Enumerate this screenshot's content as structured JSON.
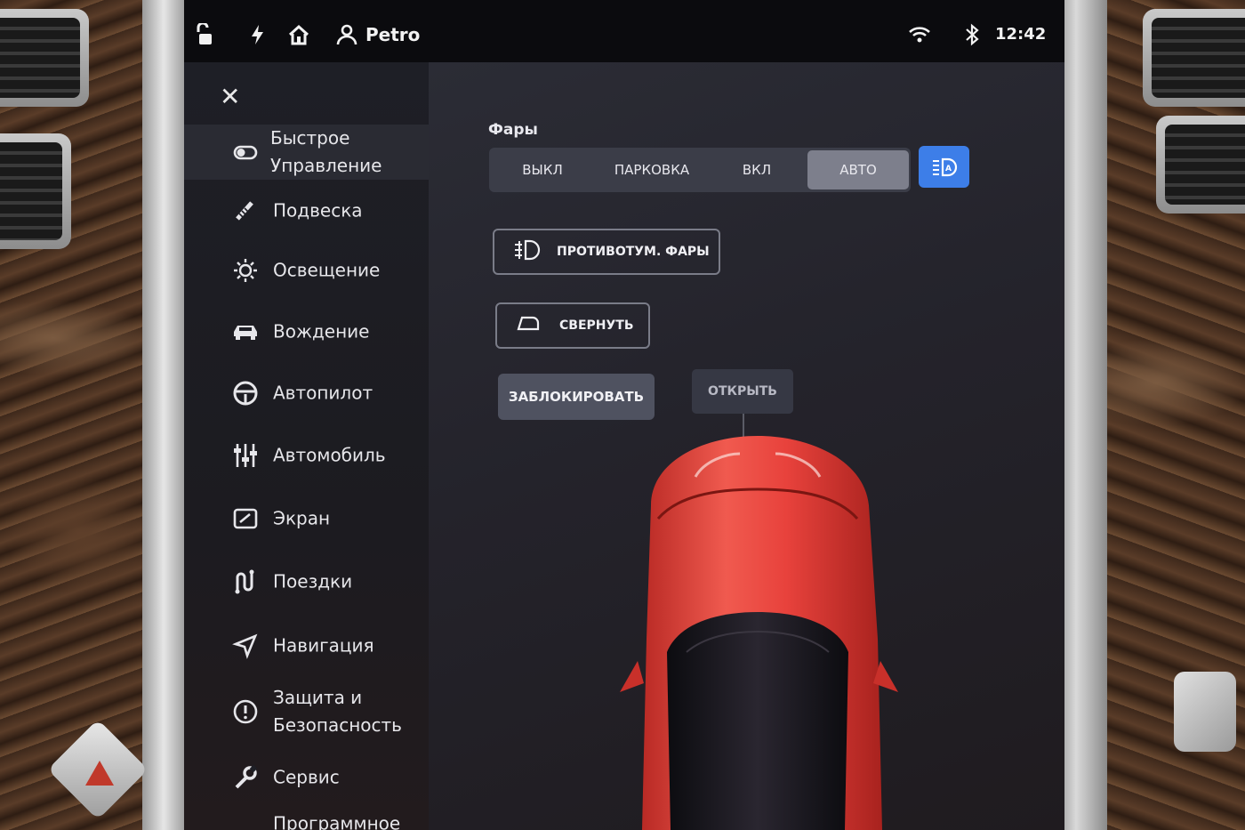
{
  "statusbar": {
    "user_name": "Petro",
    "time": "12:42"
  },
  "sidebar": {
    "items": [
      {
        "label": "Быстрое\nУправление",
        "icon": "toggle-icon",
        "active": true
      },
      {
        "label": "Подвеска",
        "icon": "suspension-icon"
      },
      {
        "label": "Освещение",
        "icon": "light-icon"
      },
      {
        "label": "Вождение",
        "icon": "car-icon"
      },
      {
        "label": "Автопилот",
        "icon": "steering-wheel-icon"
      },
      {
        "label": "Автомобиль",
        "icon": "sliders-icon"
      },
      {
        "label": "Экран",
        "icon": "display-icon"
      },
      {
        "label": "Поездки",
        "icon": "trips-icon"
      },
      {
        "label": "Навигация",
        "icon": "navigation-icon"
      },
      {
        "label": "Защита и\nБезопасность",
        "icon": "alert-icon"
      },
      {
        "label": "Сервис",
        "icon": "wrench-icon"
      },
      {
        "label": "Программное",
        "icon": "software-icon"
      }
    ]
  },
  "headlights": {
    "title": "Фары",
    "options": [
      "ВЫКЛ",
      "ПАРКОВКА",
      "ВКЛ",
      "АВТО"
    ],
    "selected": "АВТО"
  },
  "buttons": {
    "fog_lights": "ПРОТИВОТУМ. ФАРЫ",
    "fold_mirrors": "СВЕРНУТЬ",
    "lock": "ЗАБЛОКИРОВАТЬ",
    "open": "ОТКРЫТЬ"
  },
  "colors": {
    "accent_blue": "#3d7ee8",
    "car_red": "#e8423c"
  }
}
